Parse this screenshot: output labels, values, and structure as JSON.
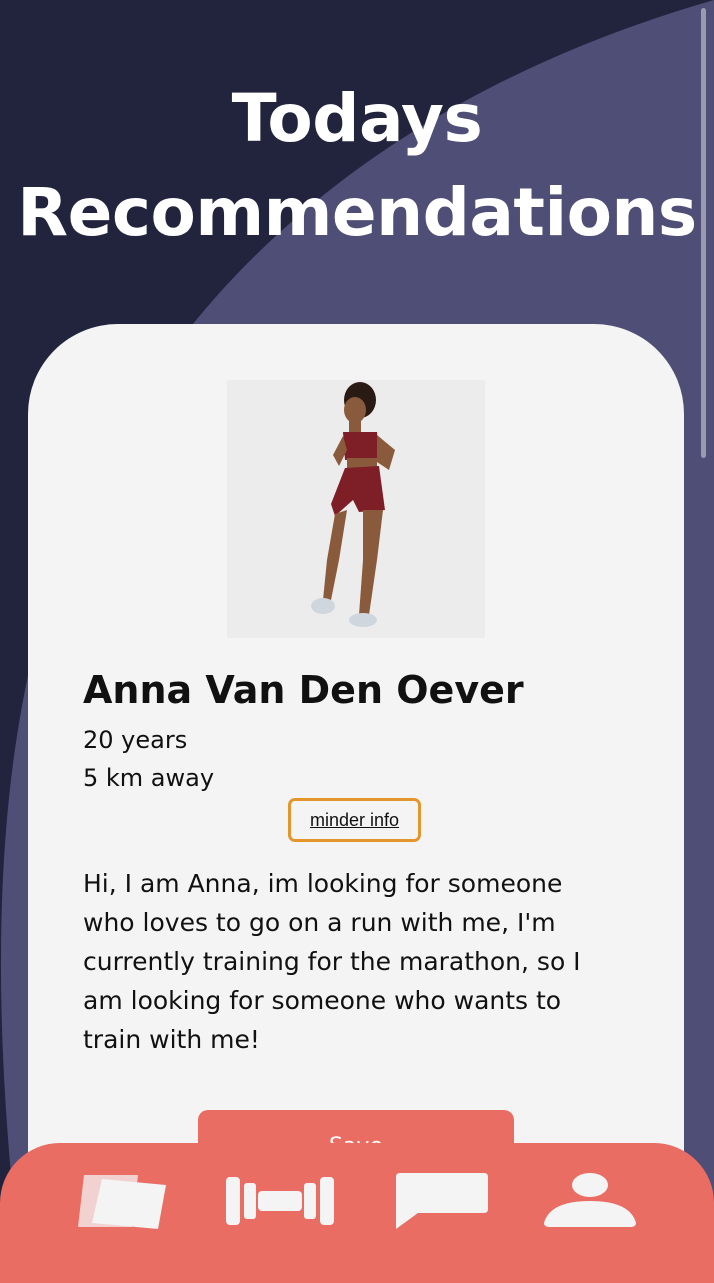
{
  "header": {
    "title_line1": "Todays",
    "title_line2": "Recommendations"
  },
  "profile": {
    "photo_icon": "person-photo",
    "name": "Anna Van Den Oever",
    "age": "20 years",
    "distance": "5 km away",
    "info_button": "minder info",
    "bio": "Hi, I am Anna, im looking for someone who loves to go on a run with me, I'm currently training for the marathon, so I am looking for someone who wants to train with me!",
    "save_button": "Save"
  },
  "tabbar": {
    "items": [
      {
        "icon": "cards-icon"
      },
      {
        "icon": "dumbbell-icon"
      },
      {
        "icon": "chat-icon"
      },
      {
        "icon": "profile-icon"
      }
    ]
  },
  "colors": {
    "background": "#22233d",
    "arc": "#4f4e77",
    "card": "#f4f4f4",
    "accent": "#ea6d63",
    "info_border": "#e3962e"
  }
}
